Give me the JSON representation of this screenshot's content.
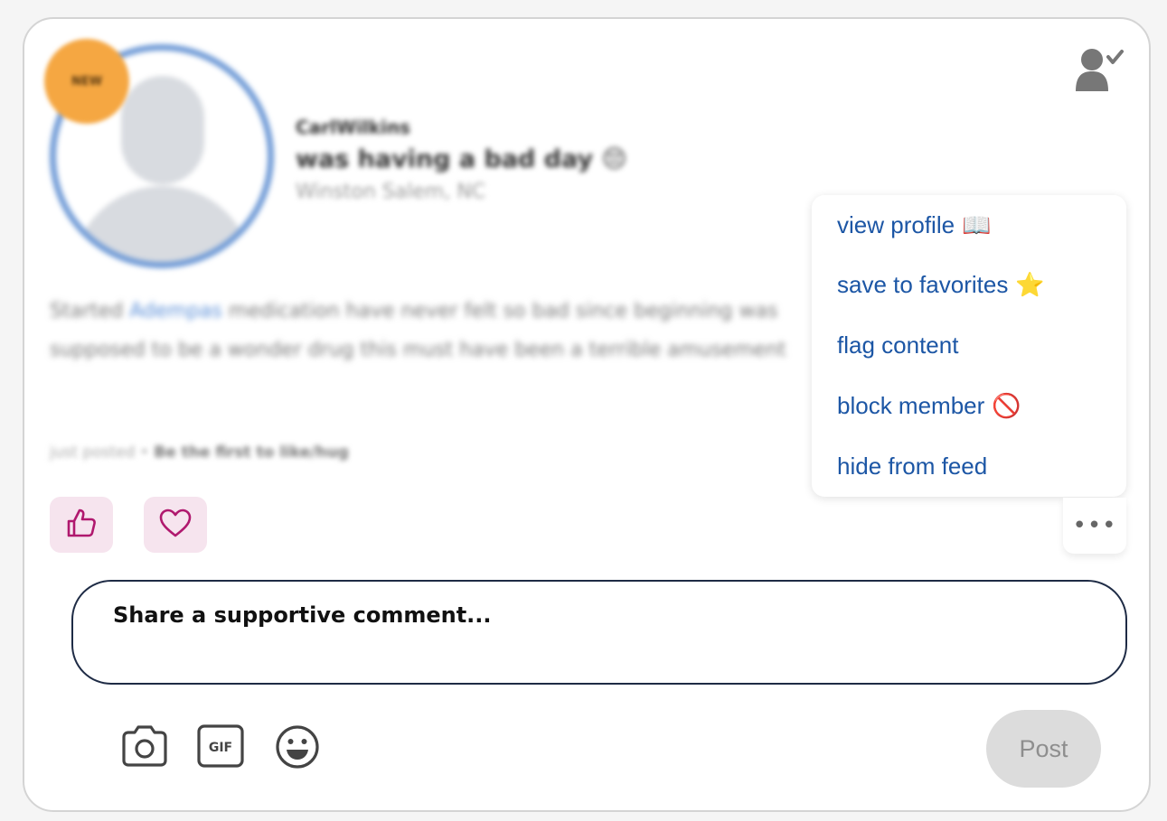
{
  "post": {
    "badge": "NEW",
    "username": "CarlWilkins",
    "status": "was having a bad day 😔",
    "location": "Winston Salem, NC",
    "body_prefix": "Started ",
    "body_drug": "Adempas",
    "body_suffix": " medication have never felt so bad since beginning was supposed to be a wonder drug this must have been a terrible amusement",
    "meta_time": "just posted",
    "meta_separator": " • ",
    "meta_cta": "Be the first to like/hug"
  },
  "menu": {
    "items": [
      {
        "label": "view profile",
        "icon": "📖",
        "icon_name": "book-icon"
      },
      {
        "label": "save to favorites",
        "icon": "⭐",
        "icon_name": "star-icon"
      },
      {
        "label": "flag content",
        "icon": "",
        "icon_name": ""
      },
      {
        "label": "block member",
        "icon": "🚫",
        "icon_name": "prohibited-icon"
      },
      {
        "label": "hide from feed",
        "icon": "",
        "icon_name": ""
      }
    ]
  },
  "more_button": "•••",
  "comment": {
    "placeholder": "Share a supportive comment..."
  },
  "post_button": "Post",
  "colors": {
    "menu_link": "#1c56a5",
    "reaction_bg": "#f6e4ee",
    "reaction_icon": "#b0186e",
    "comment_border": "#1e2b45"
  },
  "icons": [
    "user-verified-icon",
    "thumbs-up-icon",
    "heart-icon",
    "camera-icon",
    "gif-icon",
    "emoji-icon"
  ]
}
